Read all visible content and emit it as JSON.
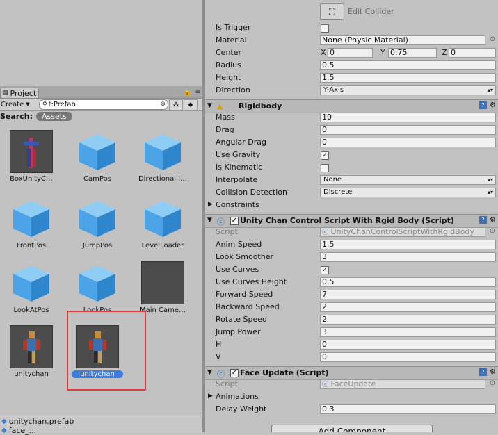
{
  "project": {
    "tab_label": "Project",
    "create_label": "Create",
    "search_value": "t:Prefab",
    "search_label": "Search:",
    "scope_label": "Assets",
    "assets": [
      {
        "name": "BoxUnityC…"
      },
      {
        "name": "CamPos"
      },
      {
        "name": "Directional l…"
      },
      {
        "name": "FrontPos"
      },
      {
        "name": "JumpPos"
      },
      {
        "name": "LevelLoader"
      },
      {
        "name": "LookAtPos"
      },
      {
        "name": "LookPos"
      },
      {
        "name": "Main Came…"
      },
      {
        "name": "unitychan"
      },
      {
        "name": "unitychan"
      }
    ],
    "status_file": "unitychan.prefab",
    "status_file2": "face_..."
  },
  "collider": {
    "edit_collider_label": "Edit Collider",
    "is_trigger_label": "Is Trigger",
    "material_label": "Material",
    "material_value": "None (Physic Material)",
    "center_label": "Center",
    "center_x": "0",
    "center_y": "0.75",
    "center_z": "0",
    "axis_x": "X",
    "axis_y": "Y",
    "axis_z": "Z",
    "radius_label": "Radius",
    "radius_value": "0.5",
    "height_label": "Height",
    "height_value": "1.5",
    "direction_label": "Direction",
    "direction_value": "Y-Axis"
  },
  "rigidbody": {
    "title": "Rigidbody",
    "mass_label": "Mass",
    "mass_value": "10",
    "drag_label": "Drag",
    "drag_value": "0",
    "angular_drag_label": "Angular Drag",
    "angular_drag_value": "0",
    "use_gravity_label": "Use Gravity",
    "is_kinematic_label": "Is Kinematic",
    "interpolate_label": "Interpolate",
    "interpolate_value": "None",
    "collision_label": "Collision Detection",
    "collision_value": "Discrete",
    "constraints_label": "Constraints"
  },
  "control_script": {
    "title": "Unity Chan Control Script With Rgid Body (Script)",
    "script_label": "Script",
    "script_value": "UnityChanControlScriptWithRgidBody",
    "anim_speed_label": "Anim Speed",
    "anim_speed_value": "1.5",
    "look_smoother_label": "Look Smoother",
    "look_smoother_value": "3",
    "use_curves_label": "Use Curves",
    "use_curves_height_label": "Use Curves Height",
    "use_curves_height_value": "0.5",
    "forward_speed_label": "Forward Speed",
    "forward_speed_value": "7",
    "backward_speed_label": "Backward Speed",
    "backward_speed_value": "2",
    "rotate_speed_label": "Rotate Speed",
    "rotate_speed_value": "2",
    "jump_power_label": "Jump Power",
    "jump_power_value": "3",
    "h_label": "H",
    "h_value": "0",
    "v_label": "V",
    "v_value": "0"
  },
  "face_update": {
    "title": "Face Update (Script)",
    "script_label": "Script",
    "script_value": "FaceUpdate",
    "animations_label": "Animations",
    "delay_weight_label": "Delay Weight",
    "delay_weight_value": "0.3"
  },
  "add_component_label": "Add Component",
  "colors": {
    "selection": "#3e7ce0",
    "highlight": "#e23a3a",
    "cube": "#4aa3e6"
  }
}
